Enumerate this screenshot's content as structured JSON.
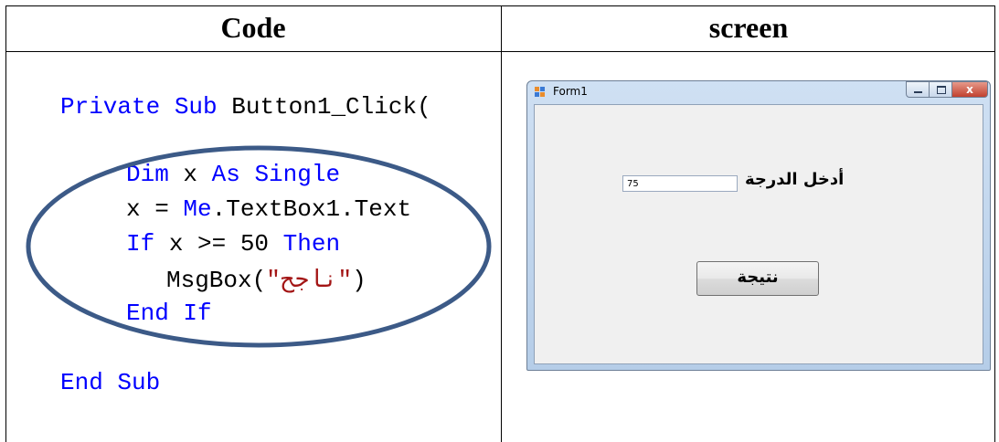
{
  "table": {
    "header_code": "Code",
    "header_screen": "screen"
  },
  "code": {
    "line1_kw": "Private Sub ",
    "line1_rest": "Button1_Click(",
    "line2_kw_dim": "Dim ",
    "line2_var": "x ",
    "line2_kw_as": "As Single",
    "line3_var": "x = ",
    "line3_kw_me": "Me",
    "line3_rest": ".TextBox1.Text",
    "line4_kw_if": "If ",
    "line4_cond": "x >= 50 ",
    "line4_kw_then": "Then",
    "line5_call": "MsgBox(",
    "line5_str": "\"ناجح\"",
    "line5_close": ")",
    "line6_kw": "End If",
    "line7_kw": "End Sub"
  },
  "form": {
    "title": "Form1",
    "close_glyph": "x",
    "textbox_value": "75",
    "label_text": "أدخل الدرجة",
    "button_label": "نتيجة"
  },
  "colors": {
    "keyword": "#0000ff",
    "string": "#a31515",
    "ellipse": "#3c5a87",
    "accent_red": "#c00000"
  }
}
